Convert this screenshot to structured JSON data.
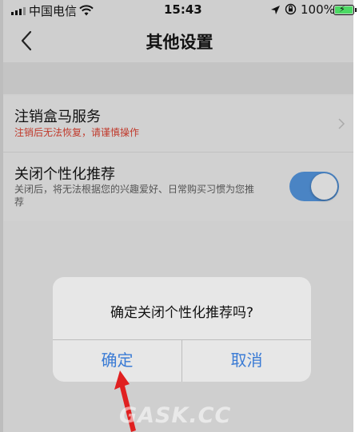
{
  "status_bar": {
    "carrier": "中国电信",
    "time": "15:43",
    "battery_percent": "100%",
    "icons": [
      "signal-icon",
      "wifi-icon",
      "location-icon",
      "orientation-lock-icon",
      "battery-charging-icon"
    ]
  },
  "nav": {
    "back_icon": "chevron-left-icon",
    "title": "其他设置"
  },
  "settings": {
    "deregister": {
      "title": "注销盒马服务",
      "warning": "注销后无法恢复，请谨慎操作",
      "warning_color": "#c0392b",
      "icon": "chevron-right-icon"
    },
    "personalization": {
      "title": "关闭个性化推荐",
      "description": "关闭后，将无法根据您的兴趣爱好、日常购买习惯为您推荐",
      "toggle_on": true,
      "toggle_color": "#4a84c4"
    }
  },
  "dialog": {
    "message": "确定关闭个性化推荐吗?",
    "confirm_label": "确定",
    "cancel_label": "取消",
    "button_color": "#3a7bd5"
  },
  "annotation": {
    "arrow_color": "#e02020",
    "arrow_icon": "red-arrow-icon"
  },
  "watermark": {
    "text": "GASK.CC"
  }
}
